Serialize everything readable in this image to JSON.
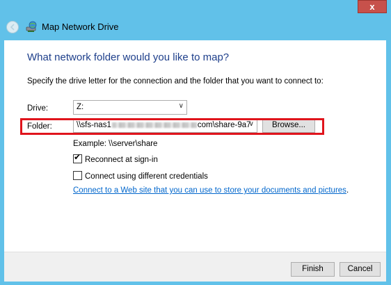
{
  "window": {
    "title": "Map Network Drive",
    "close_label": "x"
  },
  "content": {
    "heading": "What network folder would you like to map?",
    "instruction": "Specify the drive letter for the connection and the folder that you want to connect to:",
    "drive": {
      "label": "Drive:",
      "value": "Z:"
    },
    "folder": {
      "label": "Folder:",
      "value_prefix": "\\\\sfs-nas1",
      "value_suffix": "com\\share-9a7",
      "browse_label": "Browse..."
    },
    "example": "Example: \\\\server\\share",
    "reconnect": {
      "label": "Reconnect at sign-in",
      "checked": true
    },
    "different_credentials": {
      "label": "Connect using different credentials",
      "checked": false
    },
    "link": "Connect to a Web site that you can use to store your documents and pictures",
    "link_suffix": "."
  },
  "footer": {
    "finish_label": "Finish",
    "cancel_label": "Cancel"
  },
  "colors": {
    "frame": "#61c1e9",
    "heading": "#1e3f8b",
    "highlight": "#e0141c",
    "link": "#0066cc"
  },
  "icons": {
    "back": "back-arrow-icon",
    "app": "network-drive-icon",
    "dropdown": "chevron-down-icon"
  }
}
